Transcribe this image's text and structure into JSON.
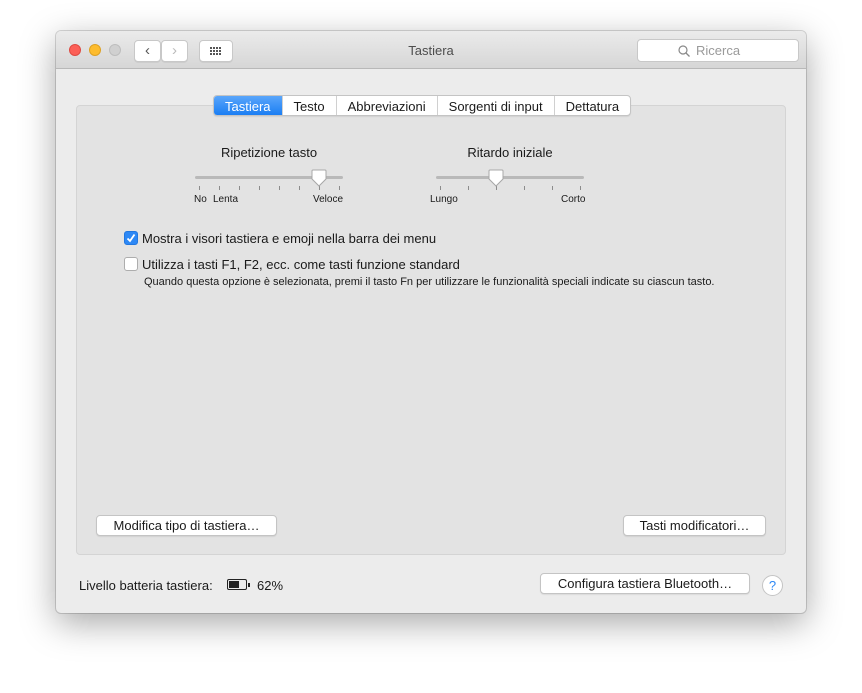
{
  "window": {
    "title": "Tastiera",
    "search_placeholder": "Ricerca"
  },
  "tabs": [
    {
      "label": "Tastiera",
      "active": true
    },
    {
      "label": "Testo"
    },
    {
      "label": "Abbreviazioni"
    },
    {
      "label": "Sorgenti di input"
    },
    {
      "label": "Dettatura"
    }
  ],
  "key_repeat": {
    "title": "Ripetizione tasto",
    "min_label": "No",
    "low_label": "Lenta",
    "max_label": "Veloce",
    "ticks": 8,
    "value": 0.857
  },
  "delay": {
    "title": "Ritardo iniziale",
    "min_label": "Lungo",
    "max_label": "Corto",
    "ticks": 6,
    "value": 0.4
  },
  "options": [
    {
      "label": "Mostra i visori tastiera e emoji nella barra dei menu",
      "checked": true
    },
    {
      "label": "Utilizza i tasti F1, F2, ecc. come tasti funzione standard",
      "checked": false,
      "help": "Quando questa opzione è selezionata, premi il tasto Fn per utilizzare le funzionalità speciali indicate su ciascun tasto."
    }
  ],
  "buttons": {
    "change_type": "Modifica tipo di tastiera…",
    "modifiers": "Tasti modificatori…",
    "bluetooth": "Configura tastiera Bluetooth…",
    "help": "?"
  },
  "battery": {
    "label": "Livello batteria tastiera:",
    "value": "62%",
    "fraction": 0.62
  }
}
